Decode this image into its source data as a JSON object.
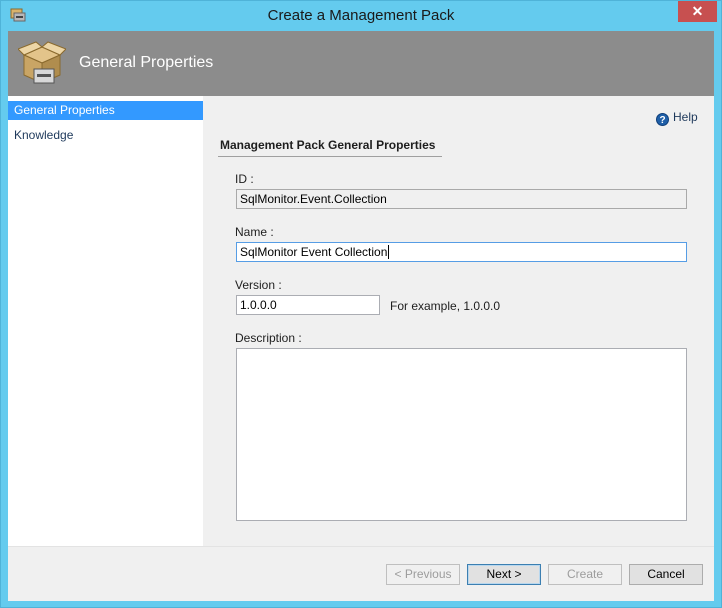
{
  "window": {
    "title": "Create a Management Pack",
    "close_glyph": "✕",
    "app_icon": "management-pack-app-icon"
  },
  "banner": {
    "title": "General Properties",
    "icon": "package-box-icon"
  },
  "nav": {
    "items": [
      {
        "label": "General Properties",
        "selected": true
      },
      {
        "label": "Knowledge",
        "selected": false
      }
    ]
  },
  "help": {
    "label": "Help",
    "icon_glyph": "?"
  },
  "form": {
    "section_title": "Management Pack General Properties",
    "id_label": "ID :",
    "id_value": "SqlMonitor.Event.Collection",
    "name_label": "Name :",
    "name_value": "SqlMonitor Event Collection",
    "version_label": "Version :",
    "version_value": "1.0.0.0",
    "version_hint": "For example, 1.0.0.0",
    "description_label": "Description :",
    "description_value": ""
  },
  "buttons": {
    "previous": "< Previous",
    "next": "Next >",
    "create": "Create",
    "cancel": "Cancel"
  },
  "colors": {
    "title_bar": "#64cbee",
    "banner": "#8c8c8c",
    "nav_selected": "#3399ff",
    "close_button": "#c75050"
  }
}
